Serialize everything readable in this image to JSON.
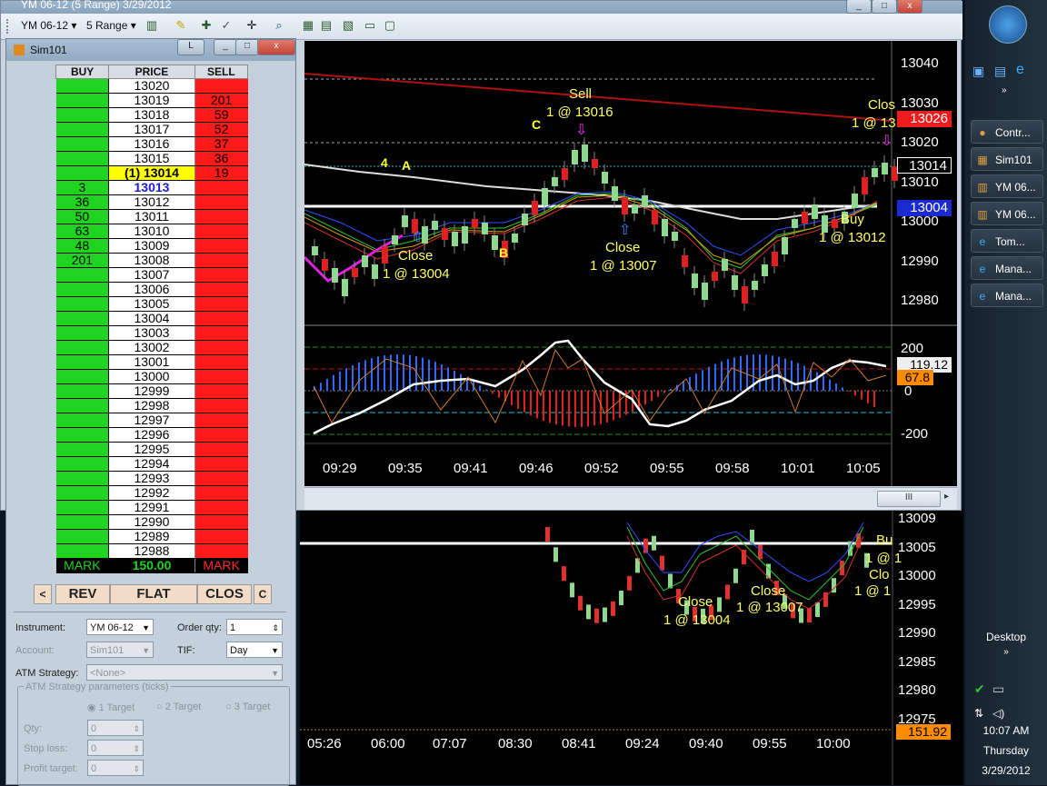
{
  "window": {
    "title": "YM 06-12 (5 Range)  3/29/2012"
  },
  "toolbar": {
    "instrument": "YM 06-12",
    "period": "5 Range"
  },
  "chart": {
    "price_axis": [
      "13040",
      "13030",
      "13020",
      "13010",
      "13000",
      "12990",
      "12980"
    ],
    "last_price_tag": "13026",
    "price_tag_2": "13014",
    "price_tag_3": "13004",
    "indicator_axis": [
      "200",
      "0",
      "-200"
    ],
    "indicator_tag_1": "119.12",
    "indicator_tag_2": "67.8",
    "time_axis": [
      "09:29",
      "09:35",
      "09:41",
      "09:46",
      "09:52",
      "09:55",
      "09:58",
      "10:01",
      "10:05"
    ],
    "annotations": {
      "sell_label": "Sell",
      "sell_fill": "1 @ 13016",
      "close1_label": "Close",
      "close1_fill": "1 @ 13004",
      "close2_label": "Close",
      "close2_fill": "1 @ 13007",
      "buy_label": "Buy",
      "buy_fill": "1 @ 13012",
      "close3_label": "Clos",
      "close3_fill": "1 @ 13",
      "letter_c": "C",
      "letter_b": "B",
      "letter_a": "A",
      "number_4": "4"
    },
    "scrollbar_grip": "III"
  },
  "chart2": {
    "price_axis": [
      "13009",
      "13005",
      "13000",
      "12995",
      "12990",
      "12985",
      "12980",
      "12975"
    ],
    "volume_tag": "151.92",
    "time_axis": [
      "05:26",
      "06:00",
      "07:07",
      "08:30",
      "08:41",
      "09:24",
      "09:40",
      "09:55",
      "10:00"
    ],
    "annotations": {
      "close1_label": "Close",
      "close1_fill": "1 @ 13004",
      "close2_label": "Close",
      "close2_fill": "1 @ 13007",
      "buy_label": "Bu",
      "buy_fill": "1 @ 1",
      "clo_label": "Clo",
      "clo_fill": "1 @ 1"
    }
  },
  "dom": {
    "title": "Sim101",
    "headers": {
      "buy": "BUY",
      "price": "PRICE",
      "sell": "SELL"
    },
    "rows": [
      {
        "buy": "",
        "price": "13020",
        "sell": ""
      },
      {
        "buy": "",
        "price": "13019",
        "sell": "201"
      },
      {
        "buy": "",
        "price": "13018",
        "sell": "59"
      },
      {
        "buy": "",
        "price": "13017",
        "sell": "52"
      },
      {
        "buy": "",
        "price": "13016",
        "sell": "37"
      },
      {
        "buy": "",
        "price": "13015",
        "sell": "36"
      },
      {
        "buy": "",
        "price": "(1) 13014",
        "sell": "19"
      },
      {
        "buy": "3",
        "price": "13013",
        "sell": ""
      },
      {
        "buy": "36",
        "price": "13012",
        "sell": ""
      },
      {
        "buy": "50",
        "price": "13011",
        "sell": ""
      },
      {
        "buy": "63",
        "price": "13010",
        "sell": ""
      },
      {
        "buy": "48",
        "price": "13009",
        "sell": ""
      },
      {
        "buy": "201",
        "price": "13008",
        "sell": ""
      },
      {
        "buy": "",
        "price": "13007",
        "sell": ""
      },
      {
        "buy": "",
        "price": "13006",
        "sell": ""
      },
      {
        "buy": "",
        "price": "13005",
        "sell": ""
      },
      {
        "buy": "",
        "price": "13004",
        "sell": ""
      },
      {
        "buy": "",
        "price": "13003",
        "sell": ""
      },
      {
        "buy": "",
        "price": "13002",
        "sell": ""
      },
      {
        "buy": "",
        "price": "13001",
        "sell": ""
      },
      {
        "buy": "",
        "price": "13000",
        "sell": ""
      },
      {
        "buy": "",
        "price": "12999",
        "sell": ""
      },
      {
        "buy": "",
        "price": "12998",
        "sell": ""
      },
      {
        "buy": "",
        "price": "12997",
        "sell": ""
      },
      {
        "buy": "",
        "price": "12996",
        "sell": ""
      },
      {
        "buy": "",
        "price": "12995",
        "sell": ""
      },
      {
        "buy": "",
        "price": "12994",
        "sell": ""
      },
      {
        "buy": "",
        "price": "12993",
        "sell": ""
      },
      {
        "buy": "",
        "price": "12992",
        "sell": ""
      },
      {
        "buy": "",
        "price": "12991",
        "sell": ""
      },
      {
        "buy": "",
        "price": "12990",
        "sell": ""
      },
      {
        "buy": "",
        "price": "12989",
        "sell": ""
      },
      {
        "buy": "",
        "price": "12988",
        "sell": ""
      }
    ],
    "mark": {
      "buy": "MARK",
      "price": "150.00",
      "sell": "MARK"
    },
    "buttons": {
      "left": "<",
      "rev": "REV",
      "flat": "FLAT",
      "close": "CLOS",
      "c": "C"
    },
    "form": {
      "instrument_label": "Instrument:",
      "instrument_value": "YM 06-12",
      "order_qty_label": "Order qty:",
      "order_qty_value": "1",
      "account_label": "Account:",
      "account_value": "Sim101",
      "tif_label": "TIF:",
      "tif_value": "Day",
      "atm_label": "ATM Strategy:",
      "atm_value": "<None>",
      "atm_params_label": "ATM Strategy parameters (ticks)",
      "target1": "1 Target",
      "target2": "2 Target",
      "target3": "3 Target",
      "qty_label": "Qty:",
      "qty_value": "0",
      "stop_label": "Stop loss:",
      "stop_value": "0",
      "profit_label": "Profit target:",
      "profit_value": "0"
    }
  },
  "taskbar": {
    "items": [
      "Contr...",
      "Sim101",
      "YM 06...",
      "YM 06...",
      "Tom...",
      "Mana...",
      "Mana..."
    ],
    "desktop_label": "Desktop",
    "time": "10:07 AM",
    "day": "Thursday",
    "date": "3/29/2012"
  },
  "colors": {
    "buy": "#1fd41f",
    "sell": "#ff1a1a",
    "highlight": "#ffff00",
    "chart_bg": "#000000",
    "annotation": "#ffff66"
  }
}
